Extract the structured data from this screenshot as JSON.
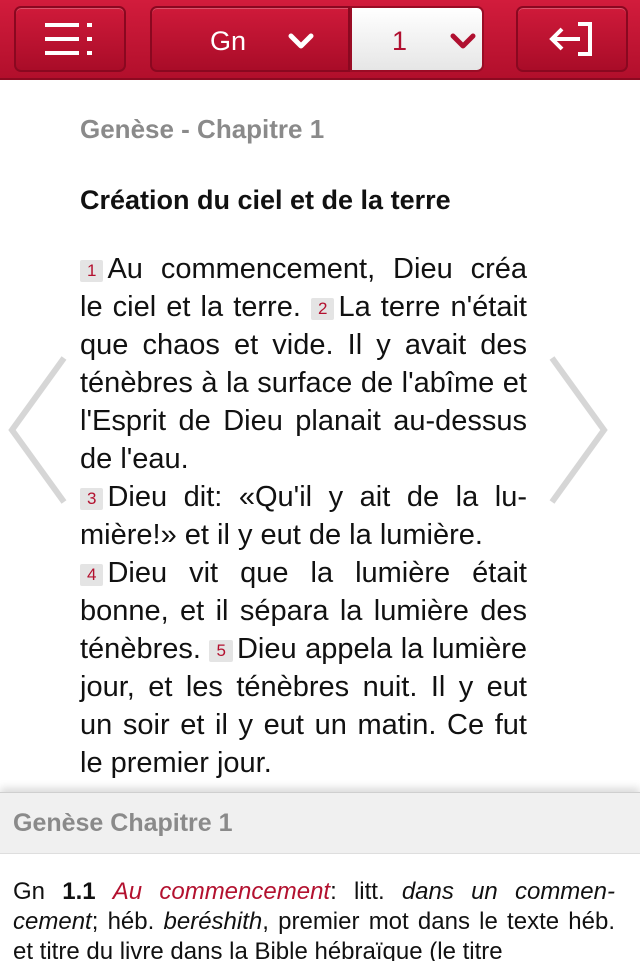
{
  "toolbar": {
    "book": "Gn",
    "chapter": "1"
  },
  "reader": {
    "chapter_header": "Genèse - Chapitre 1",
    "section_title": "Création du ciel et de la terre",
    "verses": [
      {
        "num": "1",
        "text": "Au commencement, Dieu créa le ciel et la terre."
      },
      {
        "num": "2",
        "text": "La terre n'était que chaos et vide. Il y avait des ténèbres à la sur­face de l'abîme et l'Esprit de Dieu planait au-dessus de l'eau."
      },
      {
        "num": "3",
        "text": "Dieu dit: «Qu'il y ait de la lu­mière!» et il y eut de la lumière."
      },
      {
        "num": "4",
        "text": "Dieu vit que la lumière était bonne, et il sépara la lumière des ténèbres."
      },
      {
        "num": "5",
        "text": "Dieu appela la lumière jour, et les ténèbres nuit. Il y eut un soir et il y eut un matin. Ce fut le premier jour."
      }
    ]
  },
  "notes": {
    "title": "Genèse Chapitre 1",
    "ref_book": "Gn",
    "ref_num": "1.1",
    "term": "Au commencement",
    "p1": ": litt. ",
    "p1_it": "dans un commen­cement",
    "p2": "; héb. ",
    "p2_it": "beréshith",
    "p3": ", premier mot dans le texte héb. et titre du livre dans la Bible hébraïque (le titre"
  },
  "colors": {
    "toolbar_red": "#c4142f",
    "verse_number": "#b3112f",
    "header_gray": "#8a8a8a"
  },
  "icons": {
    "menu": "list-menu-icon",
    "exit": "exit-arrow-icon",
    "dropdown": "chevron-down-icon",
    "prev": "chevron-left-icon",
    "next": "chevron-right-icon"
  }
}
